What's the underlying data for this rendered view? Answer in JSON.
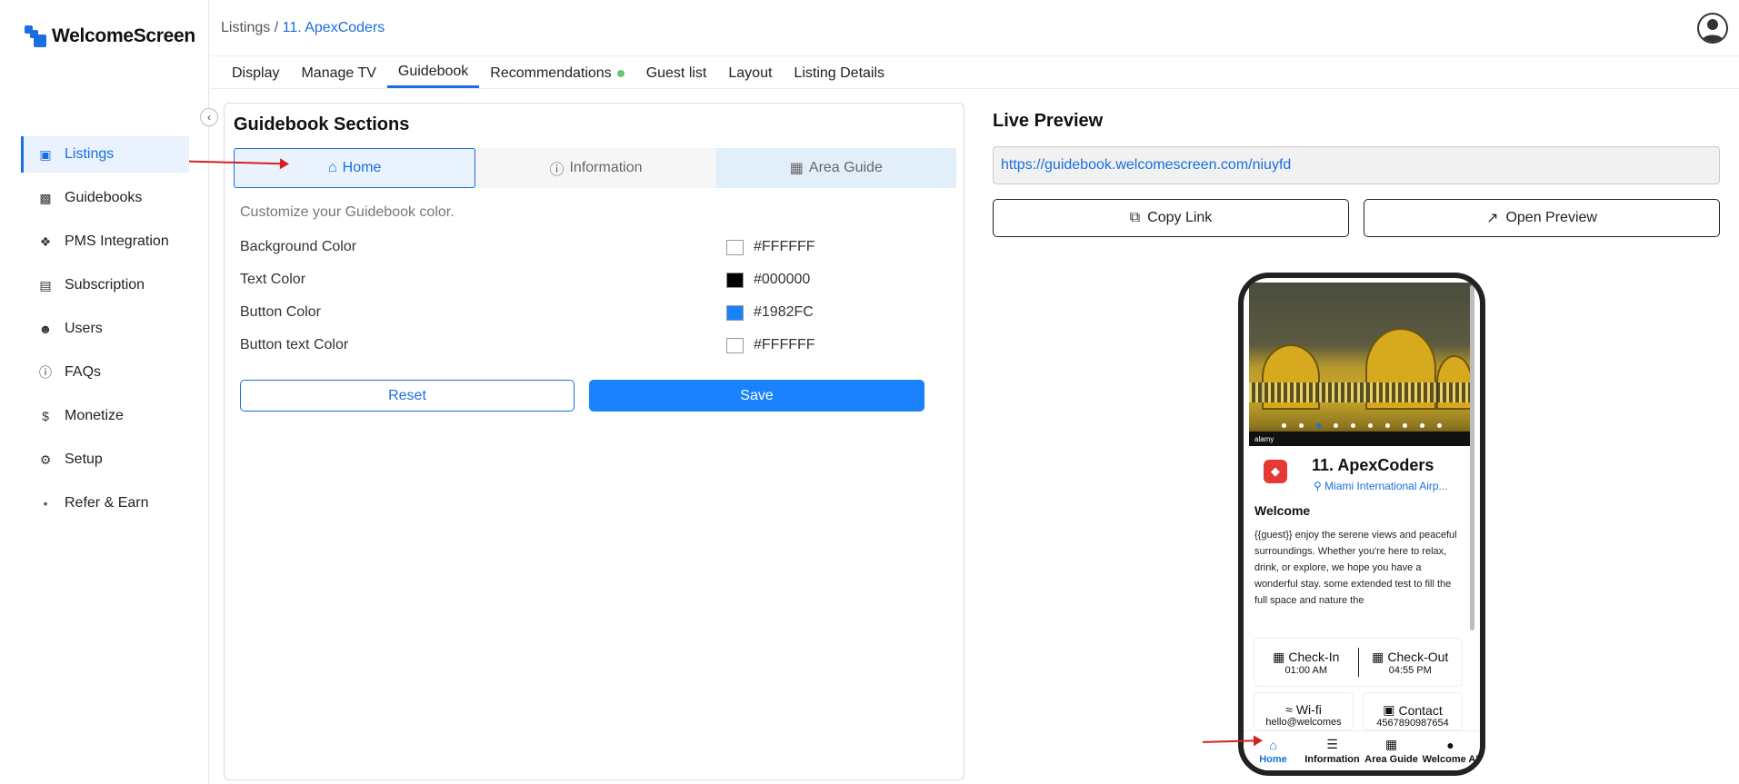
{
  "app": {
    "name": "WelcomeScreen"
  },
  "sidebar": {
    "items": [
      {
        "label": "Listings",
        "icon": "listings-icon",
        "active": true
      },
      {
        "label": "Guidebooks",
        "icon": "book-icon"
      },
      {
        "label": "PMS Integration",
        "icon": "puzzle-icon"
      },
      {
        "label": "Subscription",
        "icon": "subscription-icon"
      },
      {
        "label": "Users",
        "icon": "users-icon"
      },
      {
        "label": "FAQs",
        "icon": "question-icon"
      },
      {
        "label": "Monetize",
        "icon": "dollar-icon"
      },
      {
        "label": "Setup",
        "icon": "gear-icon"
      },
      {
        "label": "Refer & Earn",
        "icon": "share-icon"
      }
    ]
  },
  "breadcrumb": {
    "root": "Listings",
    "separator": "/",
    "current": "11. ApexCoders"
  },
  "tabs": [
    {
      "label": "Display"
    },
    {
      "label": "Manage TV"
    },
    {
      "label": "Guidebook",
      "active": true
    },
    {
      "label": "Recommendations",
      "status_dot": true
    },
    {
      "label": "Guest list"
    },
    {
      "label": "Layout"
    },
    {
      "label": "Listing Details"
    }
  ],
  "guidebook": {
    "title": "Guidebook Sections",
    "sections": [
      {
        "label": "Home",
        "icon": "home-icon",
        "active": true
      },
      {
        "label": "Information",
        "icon": "info-icon"
      },
      {
        "label": "Area Guide",
        "icon": "map-icon"
      }
    ],
    "hint": "Customize your Guidebook color.",
    "colors": [
      {
        "label": "Background Color",
        "value": "#FFFFFF"
      },
      {
        "label": "Text Color",
        "value": "#000000"
      },
      {
        "label": "Button Color",
        "value": "#1982FC"
      },
      {
        "label": "Button text Color",
        "value": "#FFFFFF"
      }
    ],
    "reset_label": "Reset",
    "save_label": "Save"
  },
  "preview": {
    "title": "Live Preview",
    "url": "https://guidebook.welcomescreen.com/niuyfd",
    "copy_label": "Copy Link",
    "open_label": "Open Preview",
    "phone": {
      "image_watermark": "alamy",
      "listing_title": "11. ApexCoders",
      "location": "Miami International Airp...",
      "welcome_heading": "Welcome",
      "welcome_text": "{{guest}} enjoy the serene views and peaceful surroundings. Whether you're here to relax, drink, or explore, we hope you have a wonderful stay. some extended test to fill the full space and nature the",
      "checkin_label": "Check-In",
      "checkin_time": "01:00 AM",
      "checkout_label": "Check-Out",
      "checkout_time": "04:55 PM",
      "wifi_label": "Wi-fi",
      "wifi_value": "hello@welcomes",
      "contact_label": "Contact",
      "contact_value": "4567890987654",
      "nav": [
        {
          "label": "Home",
          "icon": "home-icon",
          "active": true
        },
        {
          "label": "Information",
          "icon": "list-icon"
        },
        {
          "label": "Area Guide",
          "icon": "map-icon"
        },
        {
          "label": "Welcome AI",
          "icon": "ai-icon"
        }
      ]
    }
  },
  "accent_color": "#1a6fe0",
  "annotation_color": "#d32020"
}
